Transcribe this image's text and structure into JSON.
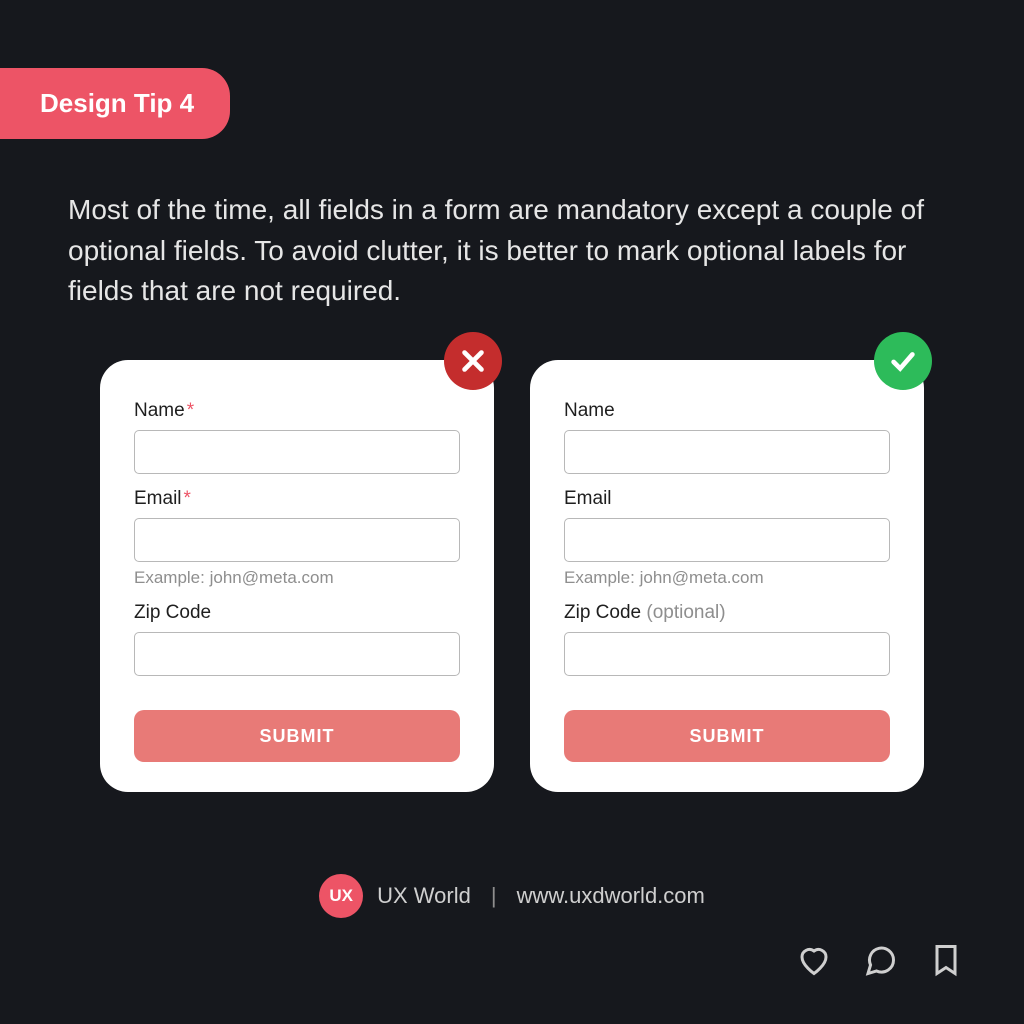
{
  "badge": "Design Tip 4",
  "description": "Most of the time, all fields in a form are mandatory except a couple of optional fields. To avoid clutter, it is better to mark optional labels for fields that are not required.",
  "asterisk": "*",
  "wrong": {
    "name_label": "Name",
    "email_label": "Email",
    "email_helper": "Example: john@meta.com",
    "zip_label": "Zip Code",
    "submit": "SUBMIT"
  },
  "right": {
    "name_label": "Name",
    "email_label": "Email",
    "email_helper": "Example: john@meta.com",
    "zip_label": "Zip Code ",
    "zip_optional": "(optional)",
    "submit": "SUBMIT"
  },
  "footer": {
    "logo": "UX",
    "brand": "UX World",
    "sep": "|",
    "url": "www.uxdworld.com"
  }
}
